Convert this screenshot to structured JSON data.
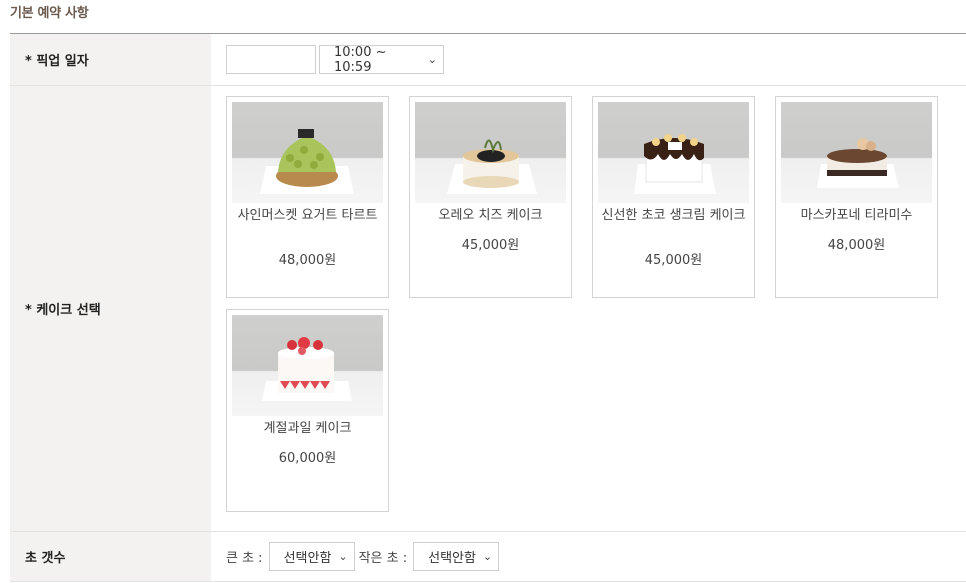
{
  "section": {
    "title": "기본 예약 사항"
  },
  "pickup": {
    "label": "* 픽업 일자",
    "date_value": "",
    "time_value": "10:00 ~ 10:59"
  },
  "cake": {
    "label": "* 케이크 선택",
    "items": [
      {
        "name": "사인머스켓 요거트 타르트",
        "price": "48,000원"
      },
      {
        "name": "오레오 치즈 케이크",
        "price": "45,000원"
      },
      {
        "name": "신선한 초코 생크림 케이크",
        "price": "45,000원"
      },
      {
        "name": "마스카포네 티라미수",
        "price": "48,000원"
      },
      {
        "name": "계절과일 케이크",
        "price": "60,000원"
      }
    ]
  },
  "candles": {
    "label": "초 갯수",
    "big_label": "큰 초 :",
    "big_value": "선택안함",
    "small_label": "작은 초 :",
    "small_value": "선택안함"
  },
  "icons": {
    "dropdown": "chevron-down-icon"
  }
}
